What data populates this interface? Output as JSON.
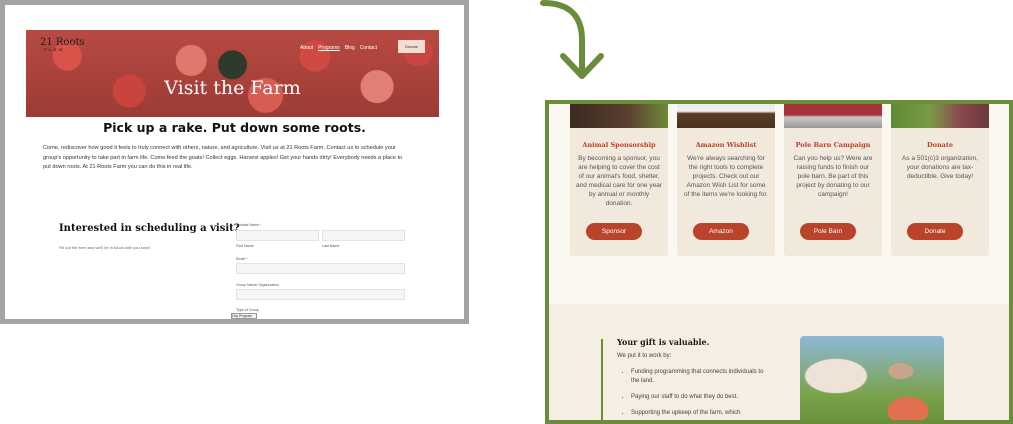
{
  "colors": {
    "arrow": "#6b8c3b",
    "frame_right": "#6b8c3b",
    "frame_left": "#a3a3a3",
    "button": "#b8442c",
    "card_title": "#b8402a"
  },
  "before": {
    "logo": {
      "text": "21 Roots",
      "sub": "FARM"
    },
    "nav": [
      "About",
      "Programs",
      "Blog",
      "Contact"
    ],
    "donate_label": "Donate",
    "hero_title": "Visit the Farm",
    "tagline": "Pick up a rake. Put down some roots.",
    "intro": "Come, rediscover how good it feels to truly connect with others, nature, and agriculture. Visit us at 21 Roots Farm. Contact us to schedule your group's opportunity to take part in farm life. Come feed the goats!  Collect eggs. Harvest apples! Get your hands dirty! Everybody needs a place to put down roots. At 21 Roots Farm you can do this in real life.",
    "form": {
      "heading": "Interested in scheduling a visit?",
      "subtext": "Fill out the form and we'll be in touch with you soon!",
      "contact_label": "Contact Name *",
      "first_label": "First Name",
      "last_label": "Last Name",
      "email_label": "Email *",
      "group_label": "Group Name/ Organization",
      "type_label": "Type of Group",
      "type_value": "Day Program"
    }
  },
  "after": {
    "cards": [
      {
        "title": "Animal Sponsorship",
        "text": "By becoming a sponsor, you are helping to cover the cost of our animal's food, shelter, and medical care for one year by annual or monthly donation.",
        "button": "Sponsor"
      },
      {
        "title": "Amazon Wishlist",
        "text": "We're always searching for the right tools to complete projects. Check out our Amazon Wish List for some of the items we're looking for.",
        "button": "Amazon"
      },
      {
        "title": "Pole Barn Campaign",
        "text": "Can you help us? Were are raising funds to finish our pole barn. Be part of this project by donating to our campaign!",
        "button": "Pole Barn"
      },
      {
        "title": "Donate",
        "text": "As a 501(c)3 organization, your donations are tax-deductible. Give today!",
        "button": "Donate"
      }
    ],
    "gift": {
      "heading": "Your gift is valuable.",
      "subtext": "We put it to work by:",
      "items": [
        "Funding programming that connects individuals to the land.",
        "Paying our staff to do what they do best.",
        "Supporting the upkeep of the farm, which"
      ]
    }
  }
}
